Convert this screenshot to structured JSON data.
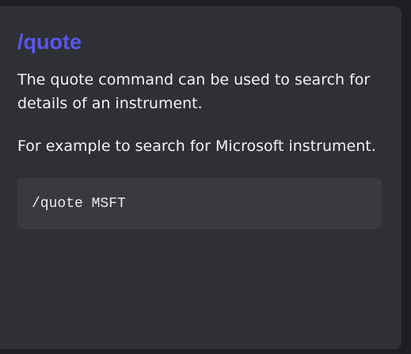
{
  "command": {
    "title": "/quote",
    "description": "The quote command can be used to search for details of an instrument.",
    "example_text": "For example to search for Microsoft instrument.",
    "example_code": "/quote MSFT"
  },
  "colors": {
    "title": "#5b55f2",
    "card_background": "#2f3035",
    "code_background": "#393a40",
    "text": "#f2f3f5"
  }
}
